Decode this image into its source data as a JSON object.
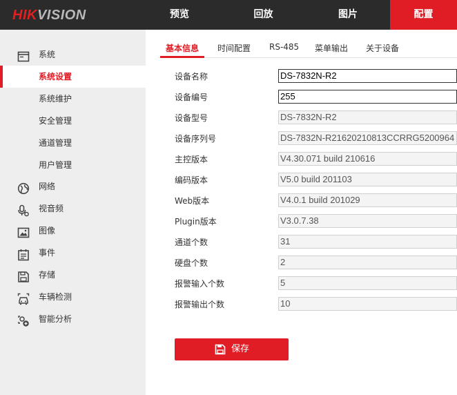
{
  "brand": {
    "logo_red": "HIK",
    "logo_grey": "VISION"
  },
  "nav": [
    {
      "label": "预览"
    },
    {
      "label": "回放"
    },
    {
      "label": "图片"
    },
    {
      "label": "配置",
      "active": true
    }
  ],
  "sidebar": {
    "items": [
      {
        "label": "系统",
        "icon": "system-window-icon"
      },
      {
        "label": "系统设置",
        "active": true
      },
      {
        "label": "系统维护"
      },
      {
        "label": "安全管理"
      },
      {
        "label": "通道管理"
      },
      {
        "label": "用户管理"
      },
      {
        "label": "网络",
        "icon": "globe-icon"
      },
      {
        "label": "视音频",
        "icon": "microphone-icon"
      },
      {
        "label": "图像",
        "icon": "image-icon"
      },
      {
        "label": "事件",
        "icon": "calendar-icon"
      },
      {
        "label": "存储",
        "icon": "floppy-icon"
      },
      {
        "label": "车辆检测",
        "icon": "car-icon"
      },
      {
        "label": "智能分析",
        "icon": "smart-analysis-icon"
      }
    ]
  },
  "tabs": [
    {
      "label": "基本信息",
      "active": true
    },
    {
      "label": "时间配置"
    },
    {
      "label": "RS-485"
    },
    {
      "label": "菜单输出"
    },
    {
      "label": "关于设备"
    }
  ],
  "form": {
    "fields": [
      {
        "label": "设备名称",
        "value": "DS-7832N-R2",
        "editable": true
      },
      {
        "label": "设备编号",
        "value": "255",
        "editable": true
      },
      {
        "label": "设备型号",
        "value": "DS-7832N-R2"
      },
      {
        "label": "设备序列号",
        "value": "DS-7832N-R21620210813CCRRG5200964"
      },
      {
        "label": "主控版本",
        "value": "V4.30.071 build 210616"
      },
      {
        "label": "编码版本",
        "value": "V5.0 build 201103"
      },
      {
        "label": "Web版本",
        "value": "V4.0.1 build 201029"
      },
      {
        "label": "Plugin版本",
        "value": "V3.0.7.38"
      },
      {
        "label": "通道个数",
        "value": "31"
      },
      {
        "label": "硬盘个数",
        "value": "2"
      },
      {
        "label": "报警输入个数",
        "value": "5"
      },
      {
        "label": "报警输出个数",
        "value": "10"
      }
    ]
  },
  "save": {
    "label": "保存",
    "icon": "floppy-save-icon"
  },
  "colors": {
    "accent": "#e01c24",
    "topbar": "#2b2b2b",
    "sidebar": "#eeeeee"
  }
}
